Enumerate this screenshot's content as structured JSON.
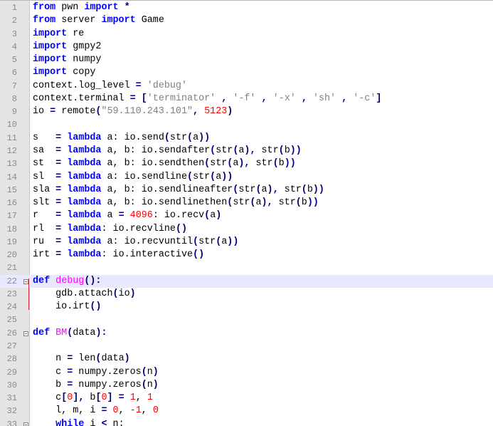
{
  "editor": {
    "colors": {
      "keyword": "#0000ff",
      "number": "#ff0000",
      "string": "#808080",
      "function_name": "#ff00ff",
      "operator": "#000080",
      "highlight_line": "#e8e8ff",
      "gutter": "#e4e4e4"
    },
    "highlighted_line": 22,
    "lines": [
      {
        "n": "1",
        "tokens": [
          {
            "t": "from",
            "c": "kw"
          },
          {
            "t": " pwn "
          },
          {
            "t": "import",
            "c": "kw"
          },
          {
            "t": " "
          },
          {
            "t": "*",
            "c": "op"
          }
        ]
      },
      {
        "n": "2",
        "tokens": [
          {
            "t": "from",
            "c": "kw"
          },
          {
            "t": " server "
          },
          {
            "t": "import",
            "c": "kw"
          },
          {
            "t": " Game"
          }
        ]
      },
      {
        "n": "3",
        "tokens": [
          {
            "t": "import",
            "c": "kw"
          },
          {
            "t": " re"
          }
        ]
      },
      {
        "n": "4",
        "tokens": [
          {
            "t": "import",
            "c": "kw"
          },
          {
            "t": " gmpy2"
          }
        ]
      },
      {
        "n": "5",
        "tokens": [
          {
            "t": "import",
            "c": "kw"
          },
          {
            "t": " numpy"
          }
        ]
      },
      {
        "n": "6",
        "tokens": [
          {
            "t": "import",
            "c": "kw"
          },
          {
            "t": " copy"
          }
        ]
      },
      {
        "n": "7",
        "tokens": [
          {
            "t": "context.log_level "
          },
          {
            "t": "=",
            "c": "op"
          },
          {
            "t": " "
          },
          {
            "t": "'debug'",
            "c": "str"
          }
        ]
      },
      {
        "n": "8",
        "tokens": [
          {
            "t": "context.terminal "
          },
          {
            "t": "=",
            "c": "op"
          },
          {
            "t": " "
          },
          {
            "t": "[",
            "c": "op"
          },
          {
            "t": "'terminator'",
            "c": "str"
          },
          {
            "t": " "
          },
          {
            "t": ",",
            "c": "op"
          },
          {
            "t": " "
          },
          {
            "t": "'-f'",
            "c": "str"
          },
          {
            "t": " "
          },
          {
            "t": ",",
            "c": "op"
          },
          {
            "t": " "
          },
          {
            "t": "'-x'",
            "c": "str"
          },
          {
            "t": " "
          },
          {
            "t": ",",
            "c": "op"
          },
          {
            "t": " "
          },
          {
            "t": "'sh'",
            "c": "str"
          },
          {
            "t": " "
          },
          {
            "t": ",",
            "c": "op"
          },
          {
            "t": " "
          },
          {
            "t": "'-c'",
            "c": "str"
          },
          {
            "t": "]",
            "c": "op"
          }
        ]
      },
      {
        "n": "9",
        "tokens": [
          {
            "t": "io "
          },
          {
            "t": "=",
            "c": "op"
          },
          {
            "t": " remote"
          },
          {
            "t": "(",
            "c": "op"
          },
          {
            "t": "\"59.110.243.101\"",
            "c": "str"
          },
          {
            "t": ",",
            "c": "op"
          },
          {
            "t": " "
          },
          {
            "t": "5123",
            "c": "num"
          },
          {
            "t": ")",
            "c": "op"
          }
        ]
      },
      {
        "n": "10",
        "tokens": []
      },
      {
        "n": "11",
        "tokens": [
          {
            "t": "s   "
          },
          {
            "t": "=",
            "c": "op"
          },
          {
            "t": " "
          },
          {
            "t": "lambda",
            "c": "kw"
          },
          {
            "t": " a: io.send"
          },
          {
            "t": "(",
            "c": "op"
          },
          {
            "t": "str"
          },
          {
            "t": "(",
            "c": "op"
          },
          {
            "t": "a"
          },
          {
            "t": "))",
            "c": "op"
          }
        ]
      },
      {
        "n": "12",
        "tokens": [
          {
            "t": "sa  "
          },
          {
            "t": "=",
            "c": "op"
          },
          {
            "t": " "
          },
          {
            "t": "lambda",
            "c": "kw"
          },
          {
            "t": " a, b: io.sendafter"
          },
          {
            "t": "(",
            "c": "op"
          },
          {
            "t": "str"
          },
          {
            "t": "(",
            "c": "op"
          },
          {
            "t": "a"
          },
          {
            "t": "),",
            "c": "op"
          },
          {
            "t": " str"
          },
          {
            "t": "(",
            "c": "op"
          },
          {
            "t": "b"
          },
          {
            "t": "))",
            "c": "op"
          }
        ]
      },
      {
        "n": "13",
        "tokens": [
          {
            "t": "st  "
          },
          {
            "t": "=",
            "c": "op"
          },
          {
            "t": " "
          },
          {
            "t": "lambda",
            "c": "kw"
          },
          {
            "t": " a, b: io.sendthen"
          },
          {
            "t": "(",
            "c": "op"
          },
          {
            "t": "str"
          },
          {
            "t": "(",
            "c": "op"
          },
          {
            "t": "a"
          },
          {
            "t": "),",
            "c": "op"
          },
          {
            "t": " str"
          },
          {
            "t": "(",
            "c": "op"
          },
          {
            "t": "b"
          },
          {
            "t": "))",
            "c": "op"
          }
        ]
      },
      {
        "n": "14",
        "tokens": [
          {
            "t": "sl  "
          },
          {
            "t": "=",
            "c": "op"
          },
          {
            "t": " "
          },
          {
            "t": "lambda",
            "c": "kw"
          },
          {
            "t": " a: io.sendline"
          },
          {
            "t": "(",
            "c": "op"
          },
          {
            "t": "str"
          },
          {
            "t": "(",
            "c": "op"
          },
          {
            "t": "a"
          },
          {
            "t": "))",
            "c": "op"
          }
        ]
      },
      {
        "n": "15",
        "tokens": [
          {
            "t": "sla "
          },
          {
            "t": "=",
            "c": "op"
          },
          {
            "t": " "
          },
          {
            "t": "lambda",
            "c": "kw"
          },
          {
            "t": " a, b: io.sendlineafter"
          },
          {
            "t": "(",
            "c": "op"
          },
          {
            "t": "str"
          },
          {
            "t": "(",
            "c": "op"
          },
          {
            "t": "a"
          },
          {
            "t": "),",
            "c": "op"
          },
          {
            "t": " str"
          },
          {
            "t": "(",
            "c": "op"
          },
          {
            "t": "b"
          },
          {
            "t": "))",
            "c": "op"
          }
        ]
      },
      {
        "n": "16",
        "tokens": [
          {
            "t": "slt "
          },
          {
            "t": "=",
            "c": "op"
          },
          {
            "t": " "
          },
          {
            "t": "lambda",
            "c": "kw"
          },
          {
            "t": " a, b: io.sendlinethen"
          },
          {
            "t": "(",
            "c": "op"
          },
          {
            "t": "str"
          },
          {
            "t": "(",
            "c": "op"
          },
          {
            "t": "a"
          },
          {
            "t": "),",
            "c": "op"
          },
          {
            "t": " str"
          },
          {
            "t": "(",
            "c": "op"
          },
          {
            "t": "b"
          },
          {
            "t": "))",
            "c": "op"
          }
        ]
      },
      {
        "n": "17",
        "tokens": [
          {
            "t": "r   "
          },
          {
            "t": "=",
            "c": "op"
          },
          {
            "t": " "
          },
          {
            "t": "lambda",
            "c": "kw"
          },
          {
            "t": " a "
          },
          {
            "t": "=",
            "c": "op"
          },
          {
            "t": " "
          },
          {
            "t": "4096",
            "c": "num"
          },
          {
            "t": ": io.recv"
          },
          {
            "t": "(",
            "c": "op"
          },
          {
            "t": "a"
          },
          {
            "t": ")",
            "c": "op"
          }
        ]
      },
      {
        "n": "18",
        "tokens": [
          {
            "t": "rl  "
          },
          {
            "t": "=",
            "c": "op"
          },
          {
            "t": " "
          },
          {
            "t": "lambda",
            "c": "kw"
          },
          {
            "t": ": io.recvline"
          },
          {
            "t": "()",
            "c": "op"
          }
        ]
      },
      {
        "n": "19",
        "tokens": [
          {
            "t": "ru  "
          },
          {
            "t": "=",
            "c": "op"
          },
          {
            "t": " "
          },
          {
            "t": "lambda",
            "c": "kw"
          },
          {
            "t": " a: io.recvuntil"
          },
          {
            "t": "(",
            "c": "op"
          },
          {
            "t": "str"
          },
          {
            "t": "(",
            "c": "op"
          },
          {
            "t": "a"
          },
          {
            "t": "))",
            "c": "op"
          }
        ]
      },
      {
        "n": "20",
        "tokens": [
          {
            "t": "irt "
          },
          {
            "t": "=",
            "c": "op"
          },
          {
            "t": " "
          },
          {
            "t": "lambda",
            "c": "kw"
          },
          {
            "t": ": io.interactive"
          },
          {
            "t": "()",
            "c": "op"
          }
        ]
      },
      {
        "n": "21",
        "tokens": []
      },
      {
        "n": "22",
        "fold": "open",
        "tokens": [
          {
            "t": "def",
            "c": "kw"
          },
          {
            "t": " "
          },
          {
            "t": "debug",
            "c": "fn"
          },
          {
            "t": "():",
            "c": "op"
          }
        ]
      },
      {
        "n": "23",
        "tokens": [
          {
            "t": "    gdb.attach"
          },
          {
            "t": "(",
            "c": "op"
          },
          {
            "t": "io"
          },
          {
            "t": ")",
            "c": "op"
          }
        ]
      },
      {
        "n": "24",
        "tokens": [
          {
            "t": "    io.irt"
          },
          {
            "t": "()",
            "c": "op"
          }
        ]
      },
      {
        "n": "25",
        "tokens": []
      },
      {
        "n": "26",
        "fold": "open",
        "tokens": [
          {
            "t": "def",
            "c": "kw"
          },
          {
            "t": " "
          },
          {
            "t": "BM",
            "c": "fn"
          },
          {
            "t": "(",
            "c": "op"
          },
          {
            "t": "data"
          },
          {
            "t": "):",
            "c": "op"
          }
        ]
      },
      {
        "n": "27",
        "tokens": []
      },
      {
        "n": "28",
        "tokens": [
          {
            "t": "    n "
          },
          {
            "t": "=",
            "c": "op"
          },
          {
            "t": " len"
          },
          {
            "t": "(",
            "c": "op"
          },
          {
            "t": "data"
          },
          {
            "t": ")",
            "c": "op"
          }
        ]
      },
      {
        "n": "29",
        "tokens": [
          {
            "t": "    c "
          },
          {
            "t": "=",
            "c": "op"
          },
          {
            "t": " numpy.zeros"
          },
          {
            "t": "(",
            "c": "op"
          },
          {
            "t": "n"
          },
          {
            "t": ")",
            "c": "op"
          }
        ]
      },
      {
        "n": "30",
        "tokens": [
          {
            "t": "    b "
          },
          {
            "t": "=",
            "c": "op"
          },
          {
            "t": " numpy.zeros"
          },
          {
            "t": "(",
            "c": "op"
          },
          {
            "t": "n"
          },
          {
            "t": ")",
            "c": "op"
          }
        ]
      },
      {
        "n": "31",
        "tokens": [
          {
            "t": "    c"
          },
          {
            "t": "[",
            "c": "op"
          },
          {
            "t": "0",
            "c": "num"
          },
          {
            "t": "],",
            "c": "op"
          },
          {
            "t": " b"
          },
          {
            "t": "[",
            "c": "op"
          },
          {
            "t": "0",
            "c": "num"
          },
          {
            "t": "]",
            "c": "op"
          },
          {
            "t": " "
          },
          {
            "t": "=",
            "c": "op"
          },
          {
            "t": " "
          },
          {
            "t": "1",
            "c": "num"
          },
          {
            "t": ","
          },
          {
            "t": " "
          },
          {
            "t": "1",
            "c": "num"
          }
        ]
      },
      {
        "n": "32",
        "tokens": [
          {
            "t": "    l, m, i "
          },
          {
            "t": "=",
            "c": "op"
          },
          {
            "t": " "
          },
          {
            "t": "0",
            "c": "num"
          },
          {
            "t": ", "
          },
          {
            "t": "-1",
            "c": "num"
          },
          {
            "t": ", "
          },
          {
            "t": "0",
            "c": "num"
          }
        ]
      },
      {
        "n": "33",
        "fold": "open",
        "tokens": [
          {
            "t": "    "
          },
          {
            "t": "while",
            "c": "kw"
          },
          {
            "t": " i "
          },
          {
            "t": "<",
            "c": "op"
          },
          {
            "t": " n:"
          }
        ]
      }
    ]
  }
}
